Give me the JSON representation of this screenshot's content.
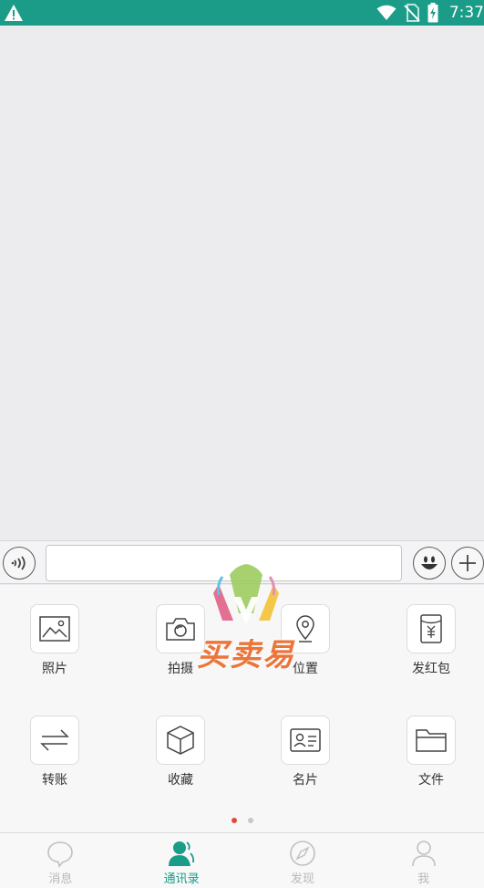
{
  "status_bar": {
    "time": "7:37",
    "icons": [
      "warning-icon",
      "wifi-icon",
      "no-sim-icon",
      "battery-charging-icon"
    ],
    "background": "#1a9c89"
  },
  "input_bar": {
    "value": "",
    "icons": [
      "voice-icon",
      "emoji-icon",
      "plus-icon"
    ]
  },
  "tools": [
    {
      "label": "照片",
      "icon": "photo-icon"
    },
    {
      "label": "拍摄",
      "icon": "camera-icon"
    },
    {
      "label": "位置",
      "icon": "location-icon"
    },
    {
      "label": "发红包",
      "icon": "red-packet-icon"
    },
    {
      "label": "转账",
      "icon": "transfer-icon"
    },
    {
      "label": "收藏",
      "icon": "favorites-icon"
    },
    {
      "label": "名片",
      "icon": "contact-card-icon"
    },
    {
      "label": "文件",
      "icon": "folder-icon"
    }
  ],
  "pager": {
    "current": 1,
    "total": 2,
    "active_color": "#e0493e"
  },
  "watermark": {
    "text": "买卖易"
  },
  "bottom_nav": {
    "items": [
      {
        "label": "消息",
        "icon": "chat-bubble-icon",
        "active": false
      },
      {
        "label": "通讯录",
        "icon": "contacts-icon",
        "active": true
      },
      {
        "label": "发现",
        "icon": "compass-icon",
        "active": false
      },
      {
        "label": "我",
        "icon": "profile-icon",
        "active": false
      }
    ],
    "active_color": "#1a9c89",
    "inactive_color": "#b8b8b8"
  }
}
